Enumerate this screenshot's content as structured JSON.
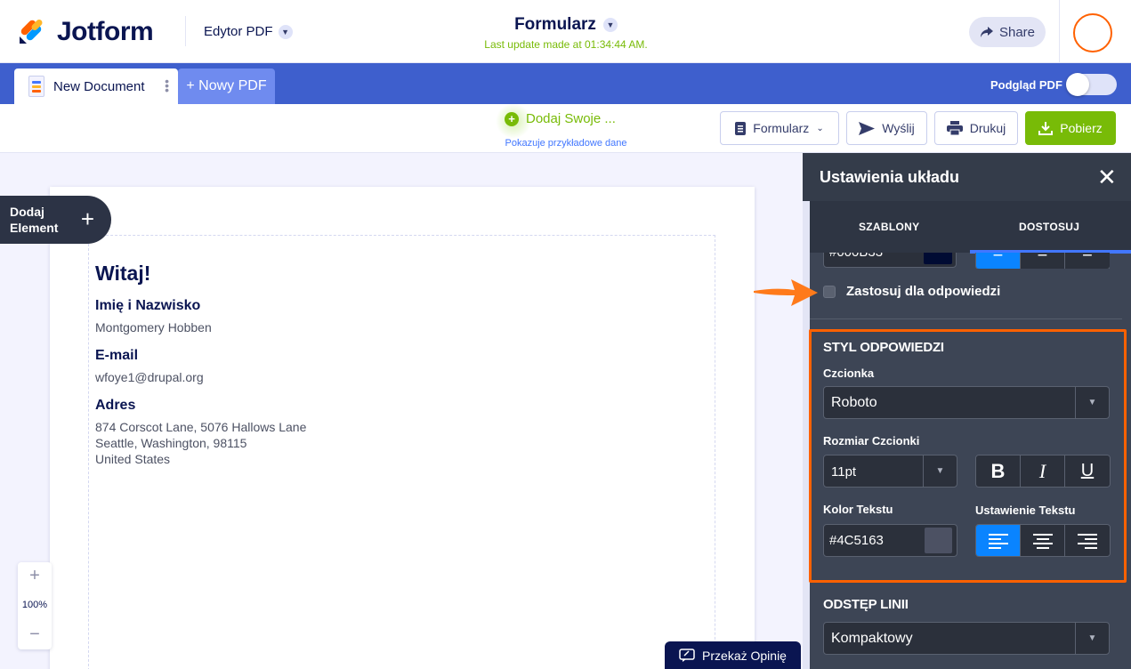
{
  "header": {
    "brand": "Jotform",
    "editor_menu": "Edytor PDF",
    "form_title": "Formularz",
    "last_update": "Last update made at 01:34:44 AM.",
    "share_label": "Share"
  },
  "tabs": {
    "document_label": "New Document",
    "new_pdf_label": "+ Nowy PDF",
    "pdf_preview_label": "Podgląd PDF",
    "pdf_preview_on": false
  },
  "toolbar": {
    "add_own_label": "Dodaj Swoje ...",
    "sample_data_label": "Pokazuje przykładowe dane",
    "form_button": "Formularz",
    "send_button": "Wyślij",
    "print_button": "Drukuj",
    "download_button": "Pobierz"
  },
  "canvas": {
    "add_element_line1": "Dodaj",
    "add_element_line2": "Element",
    "greeting": "Witaj!",
    "fields": [
      {
        "label": "Imię i Nazwisko",
        "value": "Montgomery Hobben"
      },
      {
        "label": "E-mail",
        "value": "wfoye1@drupal.org"
      },
      {
        "label": "Adres",
        "lines": [
          "874 Corscot Lane, 5076 Hallows Lane",
          "Seattle, Washington, 98115",
          "United States"
        ]
      }
    ],
    "zoom": {
      "plus": "+",
      "level": "100%",
      "minus": "−"
    },
    "feedback_label": "Przekaż Opinię"
  },
  "panel": {
    "title": "Ustawienia układu",
    "tab_templates": "SZABLONY",
    "tab_customize": "DOSTOSUJ",
    "cut_color_value": "#000B33",
    "apply_to_answers": "Zastosuj dla odpowiedzi",
    "answer_style": {
      "heading": "STYL ODPOWIEDZI",
      "font_label": "Czcionka",
      "font_value": "Roboto",
      "size_label": "Rozmiar Czcionki",
      "size_value": "11pt",
      "bold": "B",
      "italic": "I",
      "underline": "U",
      "color_label": "Kolor Tekstu",
      "color_value": "#4C5163",
      "align_label": "Ustawienie Tekstu"
    },
    "line_spacing": {
      "heading": "ODSTĘP LINII",
      "value": "Kompaktowy"
    }
  },
  "colors": {
    "accent_blue": "#3E5FCD",
    "green": "#78BB07",
    "orange_highlight": "#FF6100",
    "panel_bg": "#3D4555",
    "text_color_swatch": "#4C5163"
  }
}
